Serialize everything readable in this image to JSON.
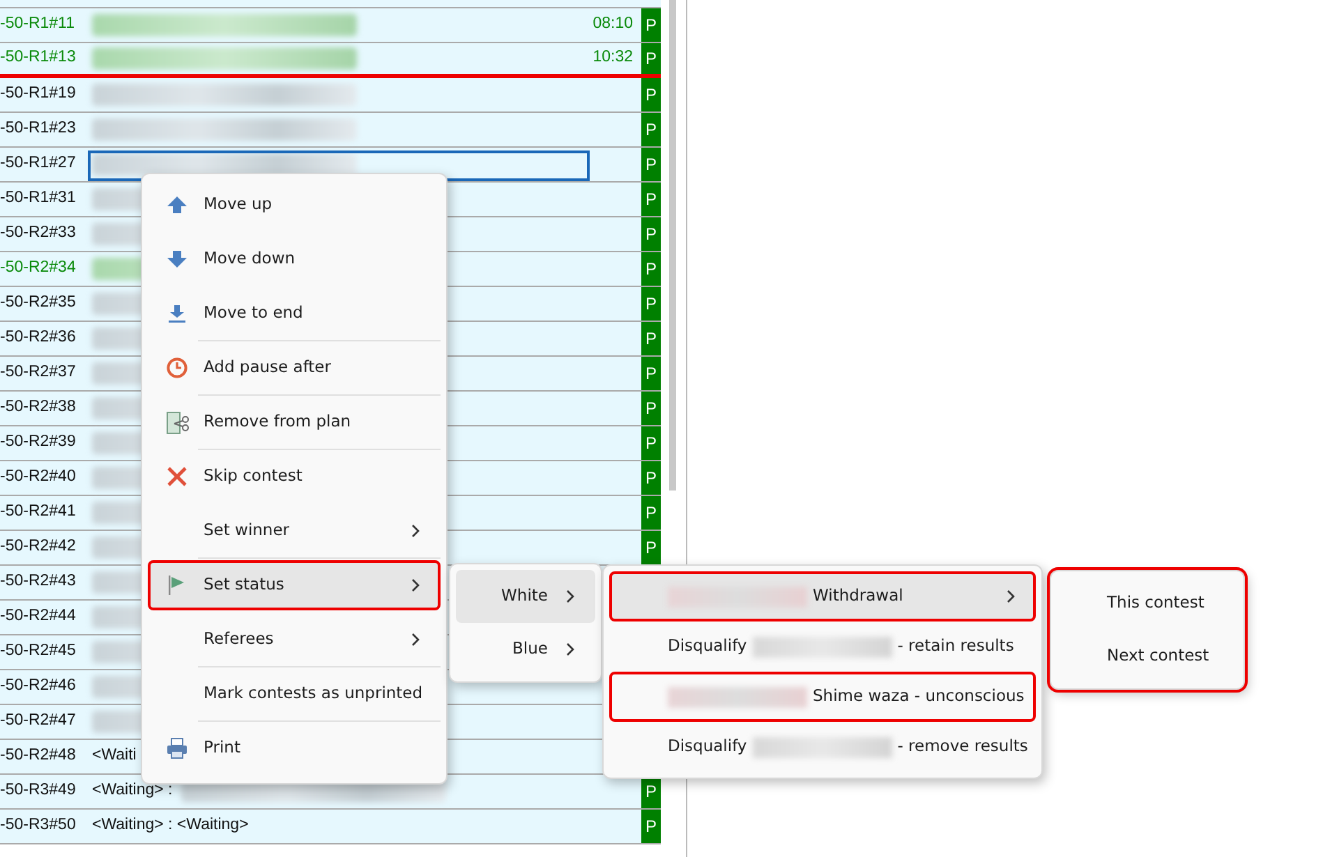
{
  "contests": [
    {
      "code": "-50-R1#11",
      "finished": true,
      "redacted": true,
      "time": "08:10",
      "status": "P",
      "line_after": false,
      "editing": false
    },
    {
      "code": "-50-R1#13",
      "finished": true,
      "redacted": true,
      "time": "10:32",
      "status": "P",
      "line_after": true,
      "editing": false
    },
    {
      "code": "-50-R1#19",
      "finished": false,
      "redacted": true,
      "status": "P",
      "line_after": false,
      "editing": false
    },
    {
      "code": "-50-R1#23",
      "finished": false,
      "redacted": true,
      "status": "P",
      "line_after": false,
      "editing": false
    },
    {
      "code": "-50-R1#27",
      "finished": false,
      "redacted": true,
      "status": "P",
      "line_after": false,
      "editing": true
    },
    {
      "code": "-50-R1#31",
      "finished": false,
      "redacted": true,
      "status": "P",
      "line_after": false,
      "editing": false
    },
    {
      "code": "-50-R2#33",
      "finished": false,
      "redacted": true,
      "status": "P",
      "line_after": false,
      "editing": false
    },
    {
      "code": "-50-R2#34",
      "finished": true,
      "redacted": true,
      "status": "P",
      "line_after": false,
      "editing": false
    },
    {
      "code": "-50-R2#35",
      "finished": false,
      "redacted": true,
      "status": "P",
      "line_after": false,
      "editing": false
    },
    {
      "code": "-50-R2#36",
      "finished": false,
      "redacted": true,
      "status": "P",
      "line_after": false,
      "editing": false
    },
    {
      "code": "-50-R2#37",
      "finished": false,
      "redacted": true,
      "status": "P",
      "line_after": false,
      "editing": false
    },
    {
      "code": "-50-R2#38",
      "finished": false,
      "redacted": true,
      "status": "P",
      "line_after": false,
      "editing": false
    },
    {
      "code": "-50-R2#39",
      "finished": false,
      "redacted": true,
      "status": "P",
      "line_after": false,
      "editing": false
    },
    {
      "code": "-50-R2#40",
      "finished": false,
      "redacted": true,
      "status": "P",
      "line_after": false,
      "editing": false
    },
    {
      "code": "-50-R2#41",
      "finished": false,
      "redacted": true,
      "status": "P",
      "line_after": false,
      "editing": false
    },
    {
      "code": "-50-R2#42",
      "finished": false,
      "redacted": true,
      "status": "P",
      "line_after": false,
      "editing": false
    },
    {
      "code": "-50-R2#43",
      "finished": false,
      "redacted": true,
      "line_after": false,
      "editing": false
    },
    {
      "code": "-50-R2#44",
      "finished": false,
      "redacted": true,
      "line_after": false,
      "editing": false
    },
    {
      "code": "-50-R2#45",
      "finished": false,
      "redacted": true,
      "line_after": false,
      "editing": false
    },
    {
      "code": "-50-R2#46",
      "finished": false,
      "redacted": true,
      "line_after": false,
      "editing": false
    },
    {
      "code": "-50-R2#47",
      "finished": false,
      "redacted": true,
      "line_after": false,
      "editing": false
    },
    {
      "code": "-50-R2#48",
      "finished": false,
      "name": "<Waiti",
      "line_after": false,
      "editing": false
    },
    {
      "code": "-50-R3#49",
      "finished": false,
      "redacted": true,
      "name": "<Waiting> :",
      "status": "P",
      "line_after": false,
      "editing": false
    },
    {
      "code": "-50-R3#50",
      "finished": false,
      "redacted": false,
      "name": "<Waiting> : <Waiting>",
      "status": "P",
      "line_after": false,
      "editing": false
    }
  ],
  "context_menu": [
    {
      "label": "Move up",
      "submenu": false,
      "selected": false,
      "annotated": false,
      "separator_after": false
    },
    {
      "label": "Move down",
      "submenu": false,
      "selected": false,
      "annotated": false,
      "separator_after": false
    },
    {
      "label": "Move to end",
      "submenu": false,
      "selected": false,
      "annotated": false,
      "separator_after": true
    },
    {
      "label": "Add pause after",
      "submenu": false,
      "selected": false,
      "annotated": false,
      "separator_after": true
    },
    {
      "label": "Remove from plan",
      "submenu": false,
      "selected": false,
      "annotated": false,
      "separator_after": true
    },
    {
      "label": "Skip contest",
      "submenu": false,
      "selected": false,
      "annotated": false,
      "separator_after": false
    },
    {
      "label": "Set winner",
      "submenu": true,
      "selected": false,
      "annotated": false,
      "separator_after": true
    },
    {
      "label": "Set status",
      "submenu": true,
      "selected": true,
      "annotated": true,
      "separator_after": false
    },
    {
      "label": "Referees",
      "submenu": true,
      "selected": false,
      "annotated": false,
      "separator_after": true
    },
    {
      "label": "Mark contests as unprinted",
      "submenu": false,
      "selected": false,
      "annotated": false,
      "separator_after": true
    },
    {
      "label": "Print",
      "submenu": false,
      "selected": false,
      "annotated": false,
      "separator_after": false
    }
  ],
  "side_menu": [
    {
      "label": "White",
      "selected": true
    },
    {
      "label": "Blue",
      "selected": false
    }
  ],
  "status_menu": [
    {
      "redacted": true,
      "after": "Withdrawal",
      "submenu": true,
      "selected": true,
      "annotated": true
    },
    {
      "before": "Disqualify",
      "redacted": true,
      "after": "- retain results",
      "submenu": false,
      "selected": false,
      "annotated": false
    },
    {
      "redacted": true,
      "after": "Shime waza - unconscious",
      "submenu": false,
      "selected": false,
      "annotated": true
    },
    {
      "before": "Disqualify",
      "redacted": true,
      "after": "- remove results",
      "submenu": false,
      "selected": false,
      "annotated": false
    }
  ],
  "when_menu": {
    "annotated": true,
    "items": [
      {
        "label": "This contest",
        "selected": false
      },
      {
        "label": "Next contest",
        "selected": false
      }
    ]
  }
}
